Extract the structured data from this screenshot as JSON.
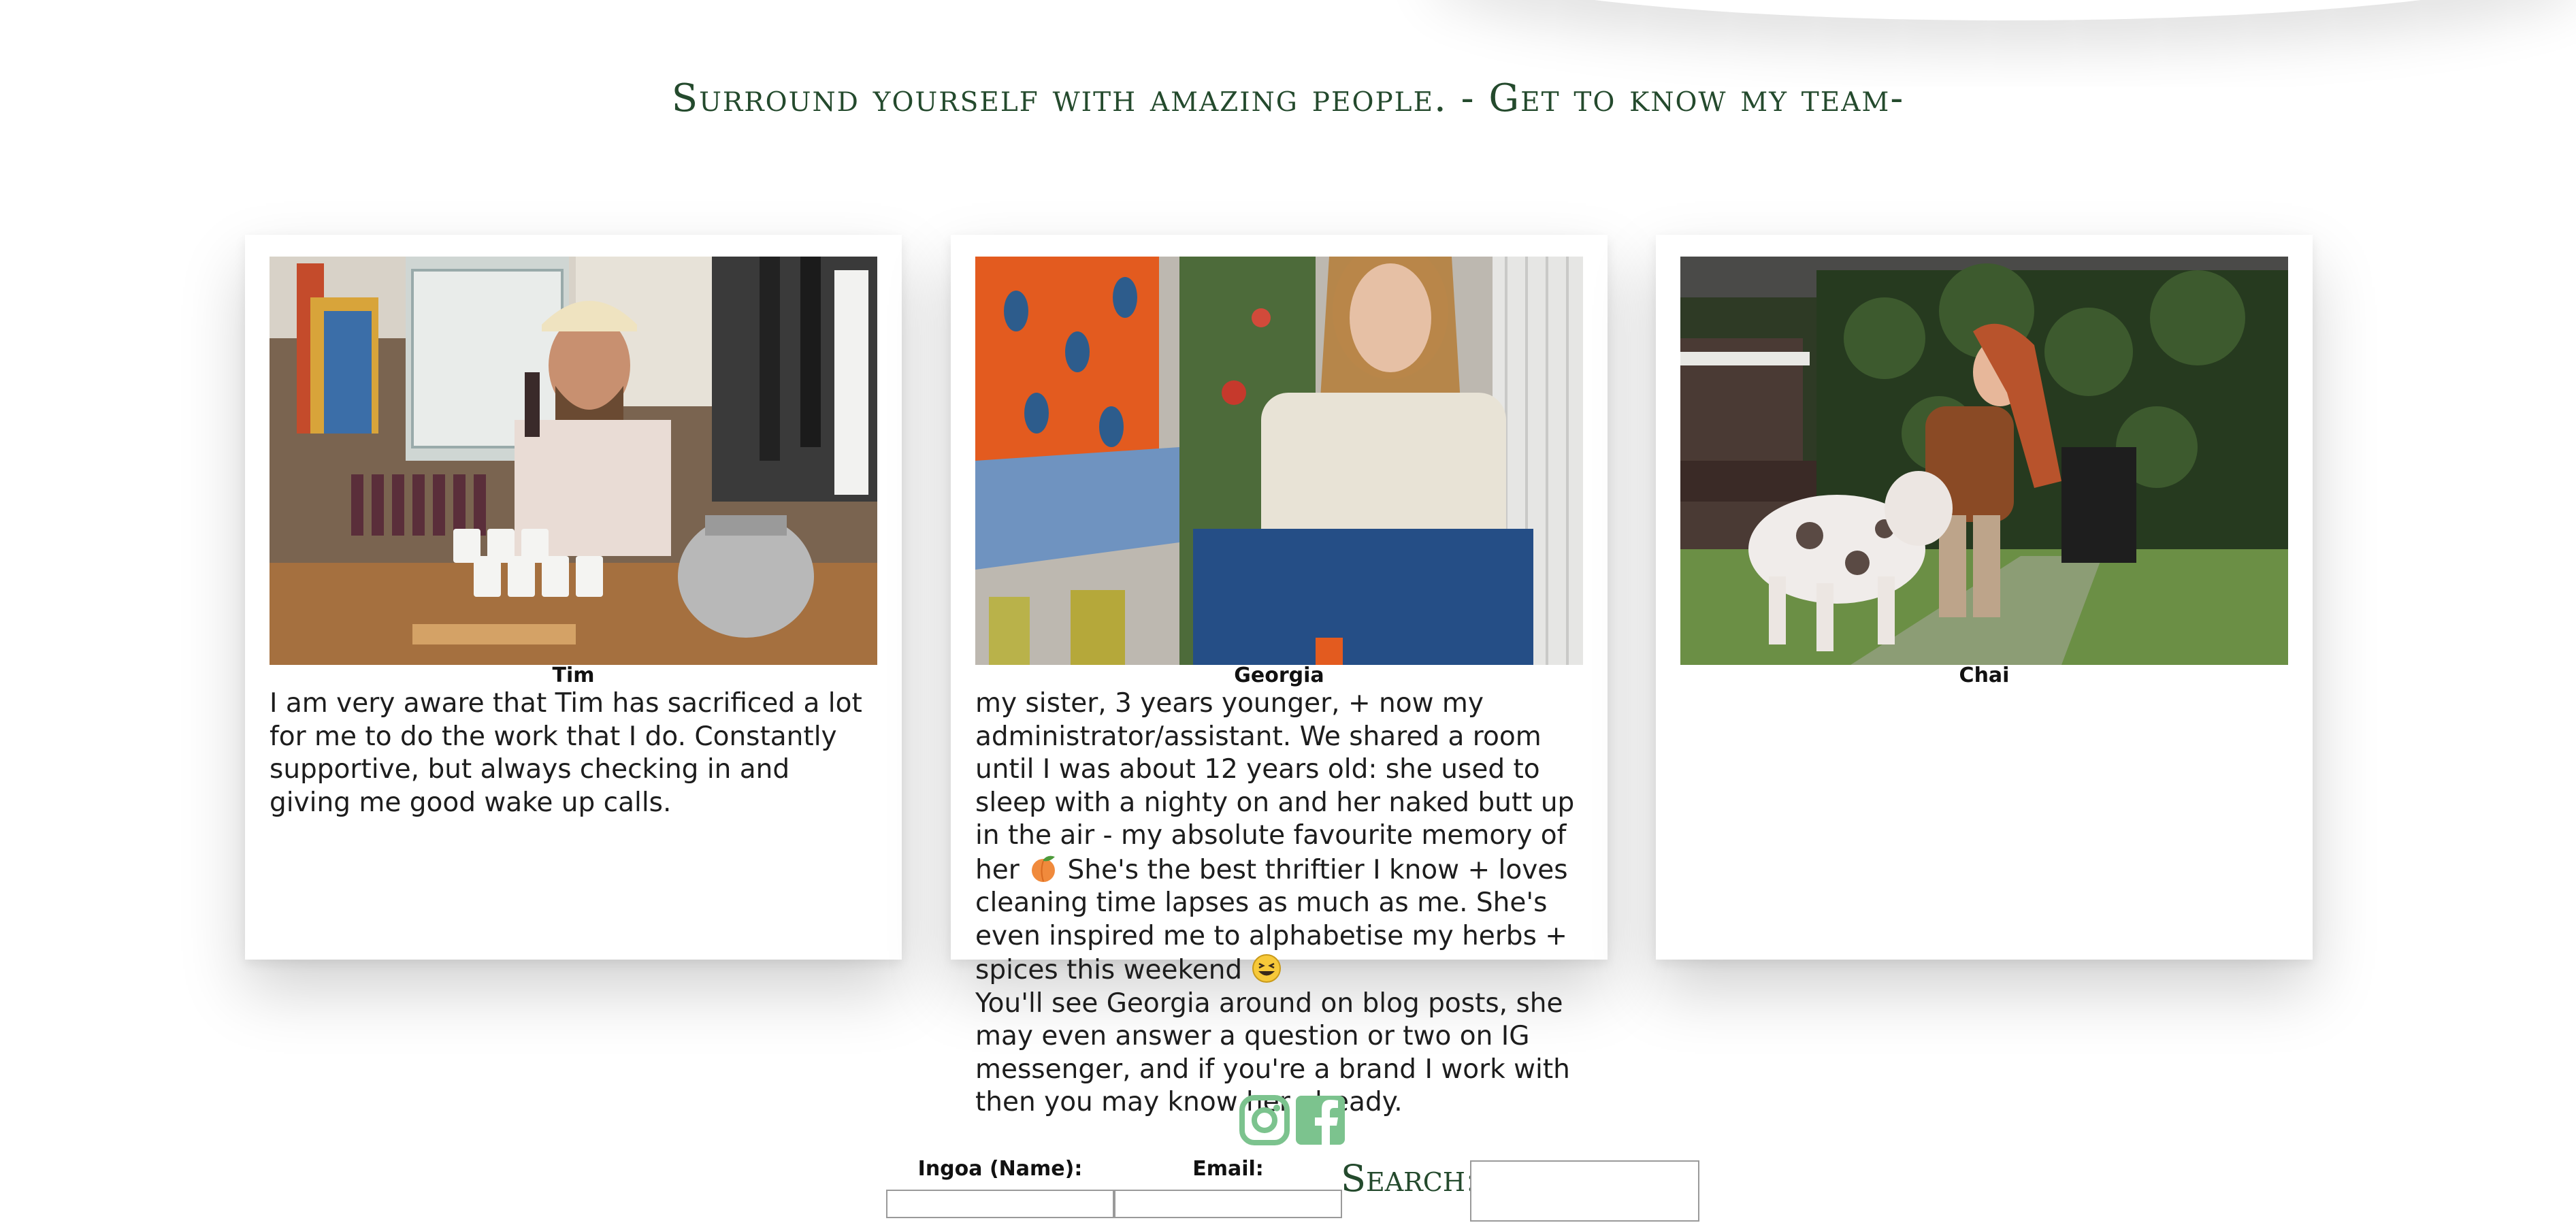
{
  "header": {
    "tagline": "Surround yourself with amazing people. - Get to know my team-"
  },
  "team": [
    {
      "name": "Tim",
      "photo_icon": "photo-tim",
      "bio": "I am very aware that Tim has sacrificed a lot for me to do the work that I do. Constantly supportive, but always checking in and giving me good wake up calls."
    },
    {
      "name": "Georgia",
      "photo_icon": "photo-georgia",
      "bio_part1": "my sister, 3 years younger, + now my administrator/assistant. We shared a room until I was about 12 years old: she used to sleep with a nighty on and her naked butt up in the air - my absolute favourite memory of her",
      "emoji1": "peach-emoji",
      "bio_part2": " She's the best thriftier I know + loves cleaning time lapses as much as me. She's even inspired me to alphabetise my herbs + spices this weekend",
      "emoji2": "grinning-squint-emoji",
      "bio_part3": "You'll see Georgia around on blog posts, she may even answer a question or two on IG messenger, and if you're a brand I work with then you may know her already."
    },
    {
      "name": "Chai",
      "photo_icon": "photo-chai",
      "bio": ""
    }
  ],
  "social": {
    "instagram_icon": "instagram-icon",
    "facebook_icon": "facebook-icon",
    "color": "#7cc38e"
  },
  "form": {
    "name_label": "Ingoa (Name):",
    "email_label": "Email:",
    "search_label": "Search:"
  },
  "colors": {
    "accent": "#244a2d",
    "social": "#7cc38e"
  }
}
